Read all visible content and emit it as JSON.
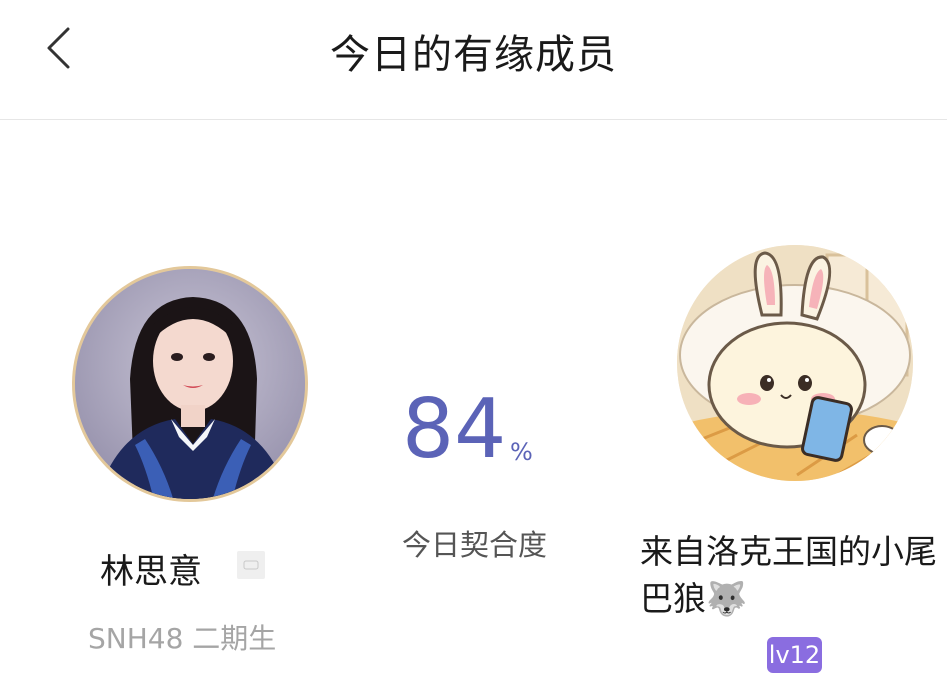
{
  "header": {
    "title": "今日的有缘成员"
  },
  "member": {
    "name": "林思意",
    "subtitle": "SNH48 二期生"
  },
  "match": {
    "score": "84",
    "unit": "%",
    "label": "今日契合度"
  },
  "user": {
    "name": "来自洛克王国的小尾巴狼🐺",
    "level": "lv12"
  },
  "colors": {
    "accent": "#5b63b7",
    "level_badge": "#8a6de0",
    "avatar_border": "#e3c89a"
  },
  "icons": {
    "back": "chevron-left-icon",
    "badge": "verified-badge-icon"
  }
}
